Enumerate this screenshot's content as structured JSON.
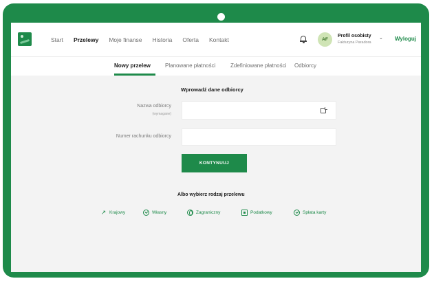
{
  "nav": {
    "items": [
      "Start",
      "Przelewy",
      "Moje finanse",
      "Historia",
      "Oferta",
      "Kontakt"
    ],
    "active_index": 1
  },
  "profile": {
    "initials": "AF",
    "name": "Profil osobisty",
    "subtitle": "Fakturyna Paradora",
    "logout_label": "Wyloguj"
  },
  "subnav": {
    "tabs": [
      "Nowy przelew",
      "Planowane płatności",
      "Zdefiniowane płatności",
      "Odbiorcy"
    ],
    "active_index": 0
  },
  "form": {
    "title": "Wprowadź dane odbiorcy",
    "recipient_label": "Nazwa odbiorcy",
    "recipient_hint": "(wymagane)",
    "recipient_value": "",
    "account_label": "Numer rachunku odbiorcy",
    "account_value": "",
    "continue_label": "KONTYNUUJ"
  },
  "alternatives": {
    "title": "Albo wybierz rodzaj przelewu",
    "options": [
      {
        "label": "Krajowy",
        "icon": "arrow-icon"
      },
      {
        "label": "Własny",
        "icon": "check-circle-icon"
      },
      {
        "label": "Zagraniczny",
        "icon": "globe-icon"
      },
      {
        "label": "Podatkowy",
        "icon": "document-icon"
      },
      {
        "label": "Spłata karty",
        "icon": "check-circle-icon"
      }
    ]
  },
  "colors": {
    "brand": "#1e8a4a",
    "screen_bg": "#f3f3f3"
  }
}
